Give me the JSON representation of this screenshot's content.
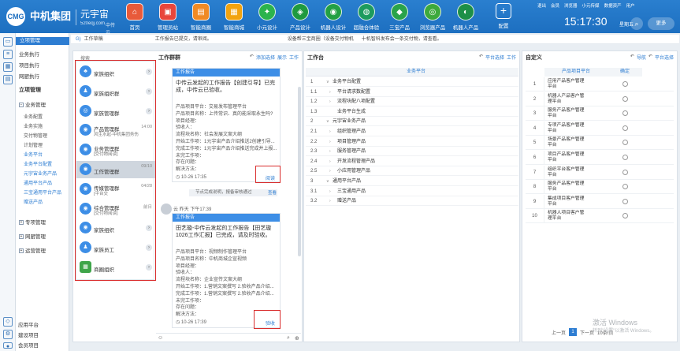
{
  "header": {
    "logo_mark": "CMG",
    "company": "中机集团",
    "brand": "元宇宙",
    "domain": "520eqj.com",
    "sub": "中传云",
    "nav": [
      {
        "label": "首页",
        "icon": "home-icon",
        "glyph": "⌂",
        "color": "#e85a3a"
      },
      {
        "label": "管理员站",
        "icon": "admin-icon",
        "glyph": "▣",
        "color": "#e8463c"
      },
      {
        "label": "智能商圈",
        "icon": "shop-icon",
        "glyph": "▤",
        "color": "#f08a24"
      },
      {
        "label": "智能商城",
        "icon": "mall-icon",
        "glyph": "▦",
        "color": "#f2a30f"
      },
      {
        "label": "小元设计",
        "icon": "design-icon",
        "glyph": "✦",
        "color": "#2bb34d"
      },
      {
        "label": "产品设计",
        "icon": "product-icon",
        "glyph": "◈",
        "color": "#1f9a3f"
      },
      {
        "label": "机器人设计",
        "icon": "robot-icon",
        "glyph": "◉",
        "color": "#23a043"
      },
      {
        "label": "超融合体验",
        "icon": "fusion-icon",
        "glyph": "◍",
        "color": "#1d9b5e"
      },
      {
        "label": "三宝产品",
        "icon": "treasure-icon",
        "glyph": "◆",
        "color": "#2aa34a"
      },
      {
        "label": "浏览器产品",
        "icon": "browser-icon",
        "glyph": "◎",
        "color": "#3da93c"
      },
      {
        "label": "机器人产品",
        "icon": "robot-product-icon",
        "glyph": "◐",
        "color": "#1d8f47"
      }
    ],
    "add_label": "配置",
    "top_links": [
      "退出",
      "会员",
      "浏览器",
      "小元传媒",
      "数据资产",
      "用户"
    ],
    "clock": "15:17:30",
    "weekday": "星期五",
    "more": "更多"
  },
  "rail": {
    "icons": [
      "folder-icon",
      "list-icon",
      "grid-icon",
      "chart-icon",
      "share-icon"
    ]
  },
  "sidebar": {
    "active": "立项管理",
    "items": [
      "业务执行",
      "项目执行",
      "网厨执行"
    ],
    "section": "立项管理",
    "group": "业务管理",
    "subs": [
      "业务配置",
      "业务实施",
      "交付物管理",
      "计划管理",
      "业务平台",
      "业务平台配置",
      "元宇宙业务产品",
      "通用平台产品",
      "三宝通用平台产品",
      "赠送产品"
    ],
    "groups2": [
      "专项管理",
      "网厨管理",
      "运营管理"
    ],
    "bottom": [
      "应用平台",
      "建设项目",
      "会员项目"
    ]
  },
  "notice": {
    "tag": "G)",
    "text1": "工作草稿",
    "text2": "工作报告已提交，请审阅。",
    "text3": "设备帮三宝商圈（设备交付物机",
    "text4": "十机智科发布会一条交付物，请查看。"
  },
  "panel_chat": {
    "title": "工作群群",
    "actions": [
      "添加选择",
      "展示",
      "工作"
    ]
  },
  "search_label": "搜索",
  "contacts": [
    {
      "name": "家族组织",
      "sub": "",
      "time": "",
      "color": "#3d8ee6",
      "glyph": "♣",
      "chev": true
    },
    {
      "name": "家族组织群",
      "sub": "",
      "time": "",
      "color": "#3d8ee6",
      "glyph": "♟",
      "chev": true
    },
    {
      "name": "家族管理群",
      "sub": "",
      "time": "",
      "color": "#3d8ee6",
      "glyph": "◎",
      "chev": true
    },
    {
      "name": "产品管理群",
      "sub": "风生水起-中机集团务伤",
      "time": "14:00",
      "color": "#3d8ee6",
      "glyph": "◉",
      "chev": false
    },
    {
      "name": "业务管理群",
      "sub": "[交付物阅读]",
      "time": "",
      "color": "#3d8ee6",
      "glyph": "◉",
      "chev": false
    },
    {
      "name": "工作管理群",
      "sub": "",
      "time": "09/10",
      "color": "#3d8ee6",
      "glyph": "◉",
      "chev": false
    },
    {
      "name": "传媒管理群",
      "sub": "[平台交",
      "time": "04/28",
      "color": "#3d8ee6",
      "glyph": "◉",
      "chev": false
    },
    {
      "name": "综合管理群",
      "sub": "[交付物阅读]",
      "time": "前日",
      "color": "#3d8ee6",
      "glyph": "◉",
      "chev": false
    },
    {
      "name": "家族组织",
      "sub": "",
      "time": "",
      "color": "#3d8ee6",
      "glyph": "◉",
      "chev": true
    },
    {
      "name": "家族员工",
      "sub": "",
      "time": "",
      "color": "#3d8ee6",
      "glyph": "♟",
      "chev": true
    },
    {
      "name": "商圈组织",
      "sub": "",
      "time": "",
      "color": "#3fa54a",
      "glyph": "▦",
      "chev": true
    }
  ],
  "card1": {
    "head": "工作报告",
    "title": "中传云发起的工作报告【创建引导】已完成，中传云已验收。",
    "lines": [
      "产品项目平台：交易发布管理平台",
      "产品项目名称：上传常识、真的能采取永生吗?",
      "项目经理：",
      "验收人：",
      "流程块名称：社会发展文案大纲",
      "开始工作项：1元宇宙产品介绍推送2创建引导...",
      "完成工作项：1元宇宙产品介绍推送完成并上报...",
      "未完工作项：",
      "存在问题：",
      "解决方法："
    ],
    "time": "10-26 17:35",
    "link": "阅读"
  },
  "sys_msg": {
    "text": "节点完成说明，报备审核通过",
    "view": "查看"
  },
  "sender": "云  昨天 下午17:39",
  "card2": {
    "head": "工作报告",
    "title": "田艺璇-中传云发起的工作报告【田艺璇1026工作汇报】已完成，请及时验收。",
    "lines": [
      "产品项目平台：视频制作管理平台",
      "产品项目名称：中机商城企宣视频",
      "项目经理：",
      "验收人：",
      "流程块名称：企业宣传文案大纲",
      "开始工作项：1.营销文案撰写 2.验收产品介绍...",
      "完成工作项：1.营销文案撰写 2.验收产品介绍...",
      "未完工作项：",
      "存在问题：",
      "解决方法："
    ],
    "time": "10-26 17:39",
    "link": "验收"
  },
  "panel_tree": {
    "title": "工作台",
    "actions": [
      "平台选择",
      "工作"
    ],
    "col": "业务平台"
  },
  "tree_rows": [
    {
      "num": "1",
      "label": "业务平台配置",
      "lvl": 0,
      "tog": "∨"
    },
    {
      "num": "1.1",
      "label": "平台请求数配置",
      "lvl": 1,
      "tog": "›"
    },
    {
      "num": "1.2",
      "label": "流程块配八项配置",
      "lvl": 1,
      "tog": "›"
    },
    {
      "num": "1.3",
      "label": "业务平台生成",
      "lvl": 1,
      "tog": ""
    },
    {
      "num": "2",
      "label": "元宇宙业务产品",
      "lvl": 0,
      "tog": "∨"
    },
    {
      "num": "2.1",
      "label": "组织管理产品",
      "lvl": 1,
      "tog": "›"
    },
    {
      "num": "2.2",
      "label": "项目管理产品",
      "lvl": 1,
      "tog": "›"
    },
    {
      "num": "2.3",
      "label": "服务管理产品",
      "lvl": 1,
      "tog": "›"
    },
    {
      "num": "2.4",
      "label": "开发流程管理产品",
      "lvl": 1,
      "tog": "›"
    },
    {
      "num": "2.5",
      "label": "小应用管理产品",
      "lvl": 1,
      "tog": "›"
    },
    {
      "num": "3",
      "label": "通用平台产品",
      "lvl": 0,
      "tog": "∨"
    },
    {
      "num": "3.1",
      "label": "三宝通用产品",
      "lvl": 1,
      "tog": "›"
    },
    {
      "num": "3.2",
      "label": "赠送产品",
      "lvl": 1,
      "tog": "›"
    }
  ],
  "panel_custom": {
    "title": "自定义",
    "actions": [
      "导航",
      "平台选择"
    ],
    "col_name": "产品项目平台",
    "col_ok": "确定"
  },
  "custom_rows": [
    {
      "no": "1",
      "name": "应用产品客户管理平台"
    },
    {
      "no": "2",
      "name": "机器人产品客户管理平台"
    },
    {
      "no": "3",
      "name": "服务产品客户管理平台"
    },
    {
      "no": "4",
      "name": "专项产品客户管理平台"
    },
    {
      "no": "5",
      "name": "场景产品客户管理平台"
    },
    {
      "no": "6",
      "name": "项目产品客户管理平台"
    },
    {
      "no": "7",
      "name": "组织平台客户管理平台"
    },
    {
      "no": "8",
      "name": "服务产品客户管理平台"
    },
    {
      "no": "9",
      "name": "集成项目客户管理平台"
    },
    {
      "no": "10",
      "name": "机器人项目客户管理平台"
    }
  ],
  "pager": {
    "prev": "上一页",
    "page": "1",
    "next": "下一页",
    "size": "10条/页"
  },
  "watermark": {
    "line1": "激活 Windows",
    "line2": "转到\"设置\"以激活 Windows。"
  }
}
